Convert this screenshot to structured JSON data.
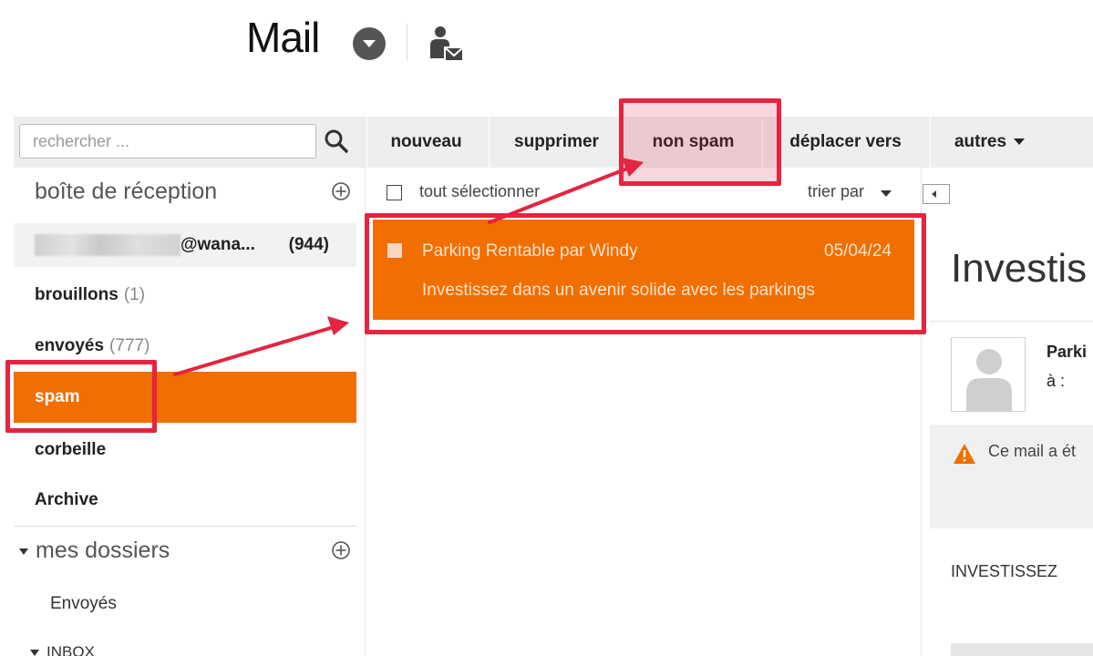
{
  "header": {
    "title": "Mail"
  },
  "search": {
    "placeholder": "rechercher ..."
  },
  "toolbar": {
    "new_label": "nouveau",
    "delete_label": "supprimer",
    "not_spam_label": "non spam",
    "move_label": "déplacer vers",
    "more_label": "autres"
  },
  "sidebar": {
    "inbox_title": "boîte de réception",
    "account_suffix": "@wana...",
    "account_count": "(944)",
    "folders": [
      {
        "label": "brouillons",
        "count": "(1)"
      },
      {
        "label": "envoyés",
        "count": "(777)"
      },
      {
        "label": "spam",
        "count": ""
      },
      {
        "label": "corbeille",
        "count": ""
      },
      {
        "label": "Archive",
        "count": ""
      }
    ],
    "my_folders_title": "mes dossiers",
    "sub_folders": [
      "Envoyés"
    ],
    "inbox_group": "INBOX"
  },
  "message_list": {
    "select_all_label": "tout sélectionner",
    "sort_label": "trier par",
    "messages": [
      {
        "sender": "Parking Rentable par Windy",
        "date": "05/04/24",
        "subject": "Investissez dans un avenir solide avec les parkings"
      }
    ]
  },
  "reader": {
    "title": "Investis",
    "from_name": "Parki",
    "to_label": "à :",
    "warning_text": "Ce mail a ét",
    "body_preview": "INVESTISSEZ"
  },
  "colors": {
    "accent": "#f16e00",
    "highlight": "#e5243f"
  }
}
